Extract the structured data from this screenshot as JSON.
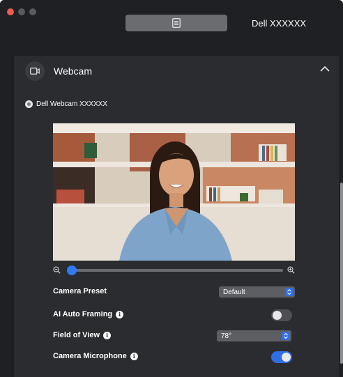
{
  "window": {
    "device_title": "Dell XXXXXX"
  },
  "section": {
    "title": "Webcam",
    "icon": "webcam-icon",
    "collapse_icon": "chevron-up-icon"
  },
  "webcam": {
    "name": "Dell Webcam XXXXXX",
    "selected": true
  },
  "zoom": {
    "level": 0.0
  },
  "settings": {
    "camera_preset": {
      "label": "Camera Preset",
      "value": "Default"
    },
    "ai_auto_framing": {
      "label": "AI Auto Framing",
      "enabled": false
    },
    "field_of_view": {
      "label": "Field of View",
      "value": "78°"
    },
    "camera_microphone": {
      "label": "Camera Microphone",
      "enabled": true
    }
  },
  "colors": {
    "accent": "#2f6fe6",
    "background": "#1f2023",
    "panel": "#2b2c30",
    "close": "#ee5a52"
  }
}
